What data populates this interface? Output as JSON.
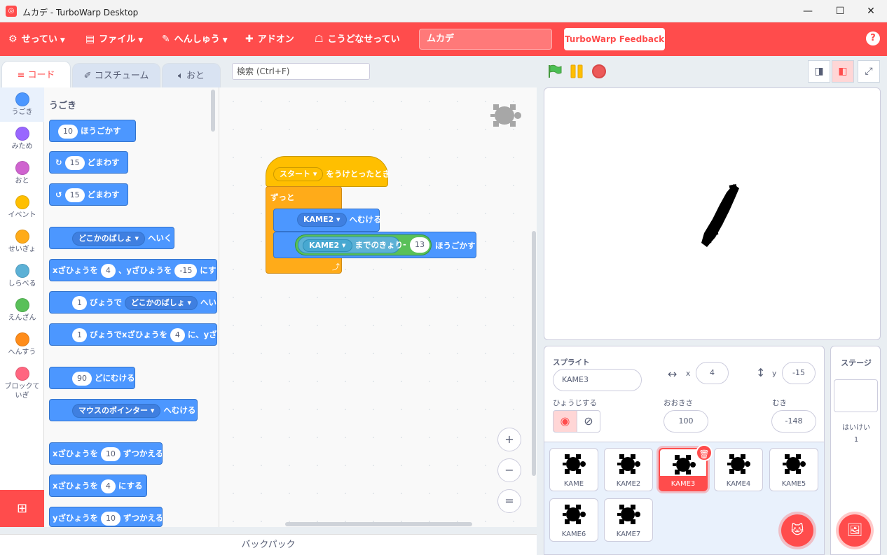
{
  "window": {
    "title": "ムカデ - TurboWarp Desktop",
    "minimize": "—",
    "maximize": "☐",
    "close": "✕"
  },
  "menubar": {
    "settings": "せってい",
    "file": "ファイル",
    "edit": "へんしゅう",
    "addons": "アドオン",
    "how_to": "こうどなせってい",
    "project_title": "ムカデ",
    "feedback": "TurboWarp Feedback",
    "help": "?"
  },
  "tabs": {
    "code": "コード",
    "costumes": "コスチューム",
    "sounds": "おと"
  },
  "search": {
    "placeholder": "検索 (Ctrl+F)"
  },
  "categories": [
    {
      "label": "うごき",
      "color": "#4c97ff"
    },
    {
      "label": "みため",
      "color": "#9966ff"
    },
    {
      "label": "おと",
      "color": "#cf63cf"
    },
    {
      "label": "イベント",
      "color": "#ffbf00"
    },
    {
      "label": "せいぎょ",
      "color": "#ffab19"
    },
    {
      "label": "しらべる",
      "color": "#5cb1d6"
    },
    {
      "label": "えんざん",
      "color": "#59c059"
    },
    {
      "label": "へんすう",
      "color": "#ff8c1a"
    },
    {
      "label": "ブロックていぎ",
      "color": "#ff6680"
    }
  ],
  "palette": {
    "header": "うごき",
    "move_val": "10",
    "move_txt": "ほうごかす",
    "turn_r_val": "15",
    "turn_r_txt": "どまわす",
    "turn_l_val": "15",
    "turn_l_txt": "どまわす",
    "goto_drop": "どこかのばしょ",
    "goto_txt": "へいく",
    "gotoxy_a": "xざひょうを",
    "gotoxy_x": "4",
    "gotoxy_b": "、yざひょうを",
    "gotoxy_y": "-15",
    "gotoxy_c": "にする",
    "glide_val": "1",
    "glide_a": "びょうで",
    "glide_drop": "どこかのばしょ",
    "glide_b": "へい",
    "glidexy_val": "1",
    "glidexy_a": "びょうでxざひょうを",
    "glidexy_x": "4",
    "glidexy_b": "に、yざ",
    "point_val": "90",
    "point_txt": "どにむける",
    "pointto_drop": "マウスのポインター",
    "pointto_txt": "へむける",
    "changex_a": "xざひょうを",
    "changex_val": "10",
    "changex_b": "ずつかえる",
    "setx_a": "xざひょうを",
    "setx_val": "4",
    "setx_b": "にする",
    "changey_a": "yざひょうを",
    "changey_val": "10",
    "changey_b": "ずつかえる"
  },
  "script": {
    "hat_drop": "スタート",
    "hat_txt": "をうけとったとき",
    "forever": "ずっと",
    "point_drop": "KAME2",
    "point_txt": "へむける",
    "dist_drop": "KAME2",
    "dist_txt": "までのきょり",
    "minus": "-",
    "minus_val": "13",
    "move_txt": "ほうごかす"
  },
  "zoom": {
    "in": "+",
    "out": "−",
    "reset": "="
  },
  "backpack": "バックパック",
  "sprite_info": {
    "label": "スプライト",
    "name": "KAME3",
    "x_label": "x",
    "x": "4",
    "y_label": "y",
    "y": "-15",
    "show_label": "ひょうじする",
    "size_label": "おおきさ",
    "size": "100",
    "direction_label": "むき",
    "direction": "-148"
  },
  "sprites": [
    "KAME",
    "KAME2",
    "KAME3",
    "KAME4",
    "KAME5",
    "KAME6",
    "KAME7"
  ],
  "selected_sprite": "KAME3",
  "stage_panel": {
    "label": "ステージ",
    "backdrops_label": "はいけい",
    "backdrops": "1"
  }
}
